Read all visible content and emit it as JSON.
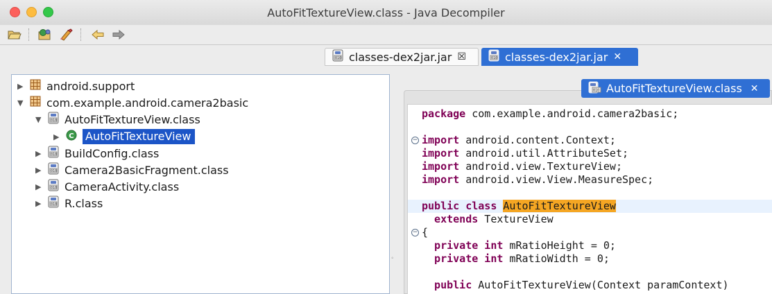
{
  "window": {
    "title": "AutoFitTextureView.class - Java Decompiler"
  },
  "toolbar": {
    "icons": [
      "open-folder-icon",
      "open-type-icon",
      "open-type-hierarchy-icon",
      "back-arrow-icon",
      "forward-arrow-icon"
    ]
  },
  "tabs": [
    {
      "label": "classes-dex2jar.jar",
      "close": "☒",
      "active": false
    },
    {
      "label": "classes-dex2jar.jar",
      "close": "✕",
      "active": true
    }
  ],
  "tree": {
    "items": [
      {
        "label": "android.support",
        "arrow": "▶",
        "icon": "package-icon"
      },
      {
        "label": "com.example.android.camera2basic",
        "arrow": "▼",
        "icon": "package-icon"
      },
      {
        "label": "AutoFitTextureView.class",
        "arrow": "▼",
        "icon": "class-file-icon"
      },
      {
        "label": "AutoFitTextureView",
        "arrow": "▶",
        "icon": "class-icon",
        "selected": true
      },
      {
        "label": "BuildConfig.class",
        "arrow": "▶",
        "icon": "class-file-icon"
      },
      {
        "label": "Camera2BasicFragment.class",
        "arrow": "▶",
        "icon": "class-file-icon"
      },
      {
        "label": "CameraActivity.class",
        "arrow": "▶",
        "icon": "class-file-icon"
      },
      {
        "label": "R.class",
        "arrow": "▶",
        "icon": "class-file-icon"
      }
    ]
  },
  "editor": {
    "tab_label": "AutoFitTextureView.class",
    "tab_close": "✕",
    "code": {
      "l1_kw": "package",
      "l1_rest": " com.example.android.camera2basic;",
      "l2_kw": "import",
      "l2_rest": " android.content.Context;",
      "l3_kw": "import",
      "l3_rest": " android.util.AttributeSet;",
      "l4_kw": "import",
      "l4_rest": " android.view.TextureView;",
      "l5_kw": "import",
      "l5_rest": " android.view.View.MeasureSpec;",
      "l6_kw": "public class",
      "l6_name": "AutoFitTextureView",
      "l7_kw": "  extends",
      "l7_rest": " TextureView",
      "l8": "{",
      "l9_kw": "  private int",
      "l9_rest": " mRatioHeight = 0;",
      "l10_kw": "  private int",
      "l10_rest": " mRatioWidth = 0;",
      "l11_kw": "  public",
      "l11_rest": " AutoFitTextureView(Context paramContext)"
    },
    "fold_marker": "−"
  },
  "colors": {
    "accent": "#2f6fd4",
    "selection": "#1c55c7",
    "keyword": "#7f0055",
    "highlight_word": "#f5a623",
    "highlight_line": "#e8f2fe"
  }
}
